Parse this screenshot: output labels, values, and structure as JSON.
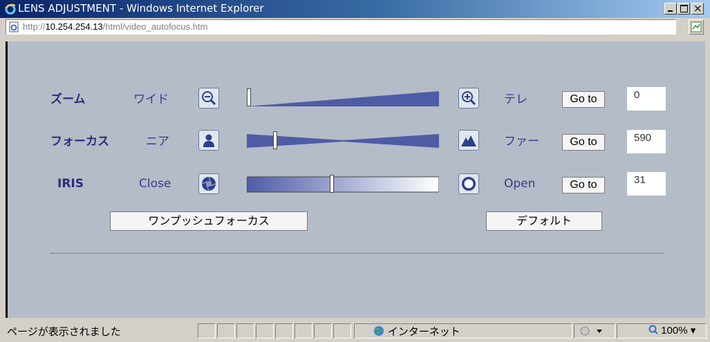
{
  "window": {
    "title": "LENS ADJUSTMENT - Windows Internet Explorer",
    "url_prefix": "http://",
    "url_host": "10.254.254.13",
    "url_path": "/html/video_autofocus.htm"
  },
  "controls": {
    "zoom": {
      "label": "ズーム",
      "left_label": "ワイド",
      "right_label": "テレ",
      "goto_label": "Go to",
      "value": "0",
      "position_fraction": 0.0
    },
    "focus": {
      "label": "フォーカス",
      "left_label": "ニア",
      "right_label": "ファー",
      "goto_label": "Go to",
      "value": "590",
      "position_fraction": 0.14
    },
    "iris": {
      "label": "IRIS",
      "left_label": "Close",
      "right_label": "Open",
      "goto_label": "Go to",
      "value": "31",
      "position_fraction": 0.44
    }
  },
  "actions": {
    "one_push_af": "ワンプッシュフォーカス",
    "default": "デフォルト"
  },
  "status": {
    "text": "ページが表示されました",
    "zone": "インターネット",
    "zoom": "100%"
  },
  "colors": {
    "slider_fill": "#4e5ca6",
    "content_bg": "#b4bcc8",
    "label_color": "#2c2c7a"
  }
}
